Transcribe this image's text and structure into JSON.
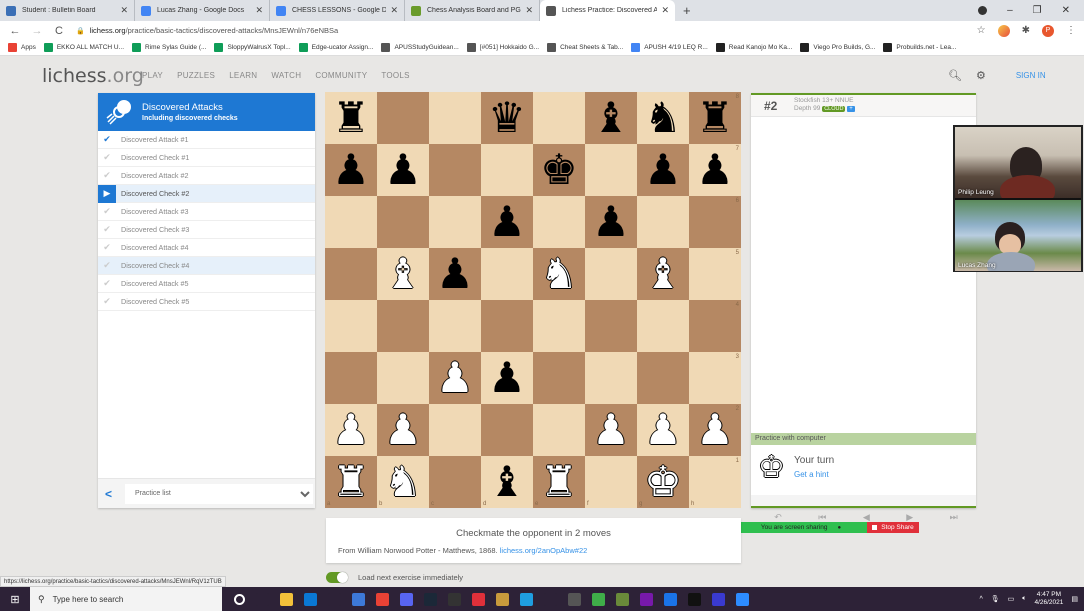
{
  "browser": {
    "tabs": [
      {
        "label": "Student : Bulletin Board",
        "icon": "bulletin-board-icon",
        "color": "#3b6fb6",
        "active": false
      },
      {
        "label": "Lucas Zhang - Google Docs",
        "icon": "google-docs-icon",
        "color": "#4285f4",
        "active": false
      },
      {
        "label": "CHESS LESSONS - Google Docs",
        "icon": "google-docs-icon",
        "color": "#4285f4",
        "active": false
      },
      {
        "label": "Chess Analysis Board and PGN E",
        "icon": "chess-pawn-icon",
        "color": "#6a9b2b",
        "active": false
      },
      {
        "label": "Lichess Practice: Discovered Atta",
        "icon": "lichess-icon",
        "color": "#555555",
        "active": true
      }
    ],
    "new_tab": "+",
    "url_domain": "lichess.org",
    "url_path": "/practice/basic-tactics/discovered-attacks/MnsJEWnl/n76eNBSa",
    "bookmarks": [
      {
        "label": "Apps",
        "color": "#e94235"
      },
      {
        "label": "EKKO ALL MATCH U...",
        "color": "#0f9d58"
      },
      {
        "label": "Rime Sylas Guide (...",
        "color": "#0f9d58"
      },
      {
        "label": "SloppyWalrusX Topl...",
        "color": "#0f9d58"
      },
      {
        "label": "Edge-ucator Assign...",
        "color": "#0f9d58"
      },
      {
        "label": "APUSStudyGuidean...",
        "color": "#555555"
      },
      {
        "label": "[#051] Hokkaido G...",
        "color": "#555555"
      },
      {
        "label": "Cheat Sheets & Tab...",
        "color": "#555555"
      },
      {
        "label": "APUSH 4/19 LEQ R...",
        "color": "#4285f4"
      },
      {
        "label": "Read Kanojo Mo Ka...",
        "color": "#222222"
      },
      {
        "label": "Viego Pro Builds, G...",
        "color": "#222222"
      },
      {
        "label": "Probuilds.net - Lea...",
        "color": "#222222"
      }
    ],
    "profile_initial": "P"
  },
  "site": {
    "logo_main": "lichess",
    "logo_tld": ".org",
    "nav": [
      "PLAY",
      "PUZZLES",
      "LEARN",
      "WATCH",
      "COMMUNITY",
      "TOOLS"
    ],
    "sign_in": "SIGN IN"
  },
  "sidebar": {
    "title": "Discovered Attacks",
    "subtitle": "Including discovered checks",
    "exercises": [
      {
        "label": "Discovered Attack #1",
        "state": "done"
      },
      {
        "label": "Discovered Check #1",
        "state": "todo"
      },
      {
        "label": "Discovered Attack #2",
        "state": "todo"
      },
      {
        "label": "Discovered Check #2",
        "state": "current"
      },
      {
        "label": "Discovered Attack #3",
        "state": "todo"
      },
      {
        "label": "Discovered Check #3",
        "state": "todo"
      },
      {
        "label": "Discovered Attack #4",
        "state": "todo"
      },
      {
        "label": "Discovered Check #4",
        "state": "highlight"
      },
      {
        "label": "Discovered Attack #5",
        "state": "todo"
      },
      {
        "label": "Discovered Check #5",
        "state": "todo"
      }
    ],
    "practice_list": "Practice list"
  },
  "board": {
    "orientation": "white",
    "ranks": [
      "8",
      "7",
      "6",
      "5",
      "4",
      "3",
      "2",
      "1"
    ],
    "files": [
      "a",
      "b",
      "c",
      "d",
      "e",
      "f",
      "g",
      "h"
    ],
    "position": [
      [
        "bR",
        "",
        "",
        "bQ",
        "",
        "bB",
        "bN",
        "bR"
      ],
      [
        "bP",
        "bP",
        "",
        "",
        "bK",
        "",
        "bP",
        "bP"
      ],
      [
        "",
        "",
        "",
        "bP",
        "",
        "bP",
        "",
        ""
      ],
      [
        "",
        "wB",
        "bP",
        "",
        "wN",
        "",
        "wB",
        ""
      ],
      [
        "",
        "",
        "",
        "",
        "",
        "",
        "",
        ""
      ],
      [
        "",
        "",
        "wP",
        "bP",
        "",
        "",
        "",
        ""
      ],
      [
        "wP",
        "wP",
        "",
        "",
        "",
        "wP",
        "wP",
        "wP"
      ],
      [
        "wR",
        "wN",
        "",
        "bB",
        "wR",
        "",
        "wK",
        ""
      ]
    ]
  },
  "analysis": {
    "pv_rank": "#2",
    "engine": "Stockfish 13+ NNUE",
    "depth": "Depth 99",
    "cloud": "CLOUD",
    "plus": "+",
    "practice_label": "Practice with computer",
    "your_turn": "Your turn",
    "hint": "Get a hint"
  },
  "controls": [
    "↶",
    "⏮",
    "◀",
    "▶",
    "⏭"
  ],
  "zoom_share": {
    "sharing": "You are screen sharing",
    "stop": "Stop Share"
  },
  "exercise": {
    "goal": "Checkmate the opponent in 2 moves",
    "source": "From William Norwood Potter - Matthews, 1868.",
    "link": "lichess.org/2anOpAbw#22",
    "autonext": "Load next exercise immediately",
    "autonext_on": true
  },
  "status_url": "https://lichess.org/practice/basic-tactics/discovered-attacks/MnsJEWnl/RqV1zTUB",
  "video": {
    "participants": [
      "Philip Leung",
      "Lucas Zhang"
    ]
  },
  "taskbar": {
    "search_placeholder": "Type here to search",
    "time": "4:47 PM",
    "date": "4/26/2021",
    "apps": [
      {
        "name": "cortana-icon",
        "color": "#2d2237"
      },
      {
        "name": "task-view-icon",
        "color": "#2d2237"
      },
      {
        "name": "file-explorer-icon",
        "color": "#f3c13a"
      },
      {
        "name": "mail-icon",
        "color": "#0a78d4"
      },
      {
        "name": "app-icon",
        "color": "#2d2237"
      },
      {
        "name": "app-icon",
        "color": "#3d79d8"
      },
      {
        "name": "chrome-icon",
        "color": "#e94235"
      },
      {
        "name": "discord-icon",
        "color": "#5865f2"
      },
      {
        "name": "steam-icon",
        "color": "#1b2838"
      },
      {
        "name": "obs-icon",
        "color": "#333333"
      },
      {
        "name": "app-icon",
        "color": "#e0303a"
      },
      {
        "name": "league-icon",
        "color": "#c89b3c"
      },
      {
        "name": "app-icon",
        "color": "#1f9ee0"
      },
      {
        "name": "settings-icon",
        "color": "#2d2237"
      },
      {
        "name": "app-icon",
        "color": "#555555"
      },
      {
        "name": "app-icon",
        "color": "#3fae49"
      },
      {
        "name": "app-icon",
        "color": "#6a8a3a"
      },
      {
        "name": "onenote-icon",
        "color": "#7719aa"
      },
      {
        "name": "app-icon",
        "color": "#1a73e8"
      },
      {
        "name": "app-icon",
        "color": "#111111"
      },
      {
        "name": "app-icon",
        "color": "#3a3ad0"
      },
      {
        "name": "zoom-icon",
        "color": "#2d8cff"
      }
    ]
  }
}
